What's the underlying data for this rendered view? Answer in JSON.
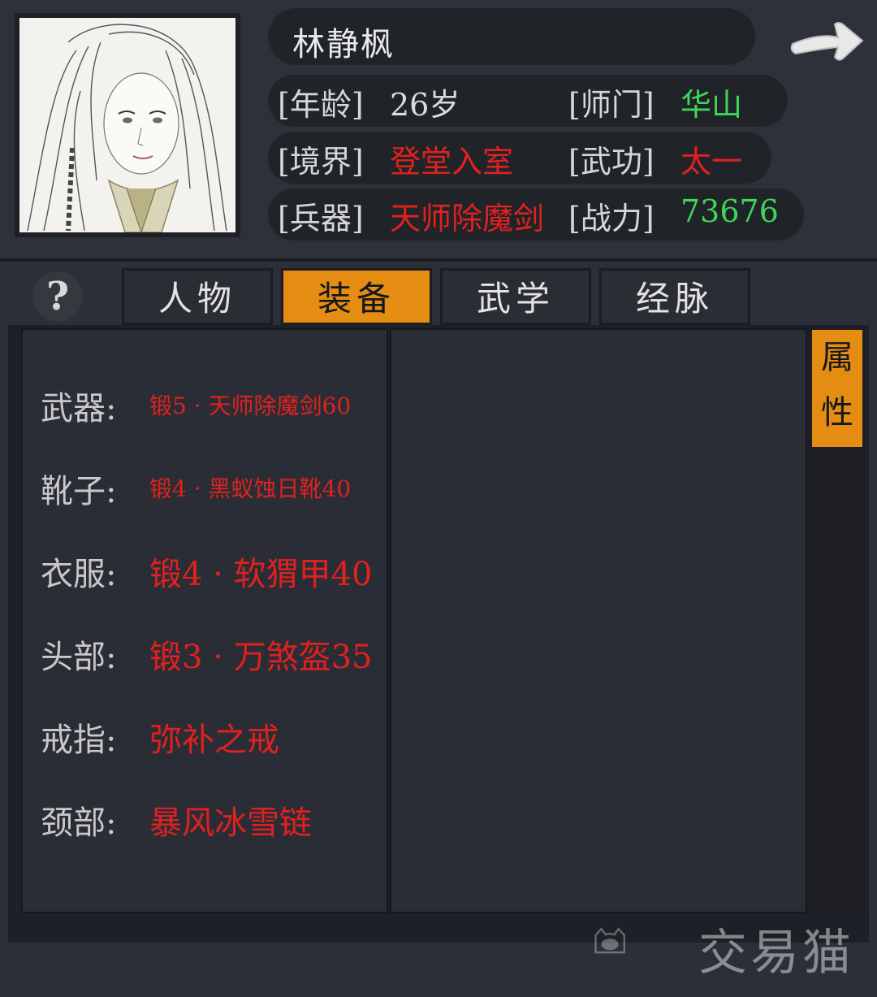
{
  "character": {
    "name": "林静枫",
    "age_label": "[年龄]",
    "age": "26岁",
    "sect_label": "[师门]",
    "sect": "华山",
    "realm_label": "[境界]",
    "realm": "登堂入室",
    "skill_label": "[武功]",
    "skill": "太一",
    "weapon_label": "[兵器]",
    "weapon": "天师除魔剑",
    "power_label": "[战力]",
    "power": "73676"
  },
  "help": "?",
  "tabs": [
    {
      "label": "人物",
      "active": false
    },
    {
      "label": "装备",
      "active": true
    },
    {
      "label": "武学",
      "active": false
    },
    {
      "label": "经脉",
      "active": false
    }
  ],
  "side_tab": {
    "char1": "属",
    "char2": "性"
  },
  "equipment": [
    {
      "slot": "武器:",
      "item": "锻5 · 天师除魔剑60"
    },
    {
      "slot": "靴子:",
      "item": "锻4 · 黑蚁蚀日靴40"
    },
    {
      "slot": "衣服:",
      "item": "锻4 · 软猬甲40"
    },
    {
      "slot": "头部:",
      "item": "锻3 · 万煞盔35"
    },
    {
      "slot": "戒指:",
      "item": "弥补之戒"
    },
    {
      "slot": "颈部:",
      "item": "暴风冰雪链"
    }
  ],
  "watermark": "交易猫",
  "colors": {
    "accent": "#e58d12",
    "red": "#e0211f",
    "green": "#3fd657"
  }
}
